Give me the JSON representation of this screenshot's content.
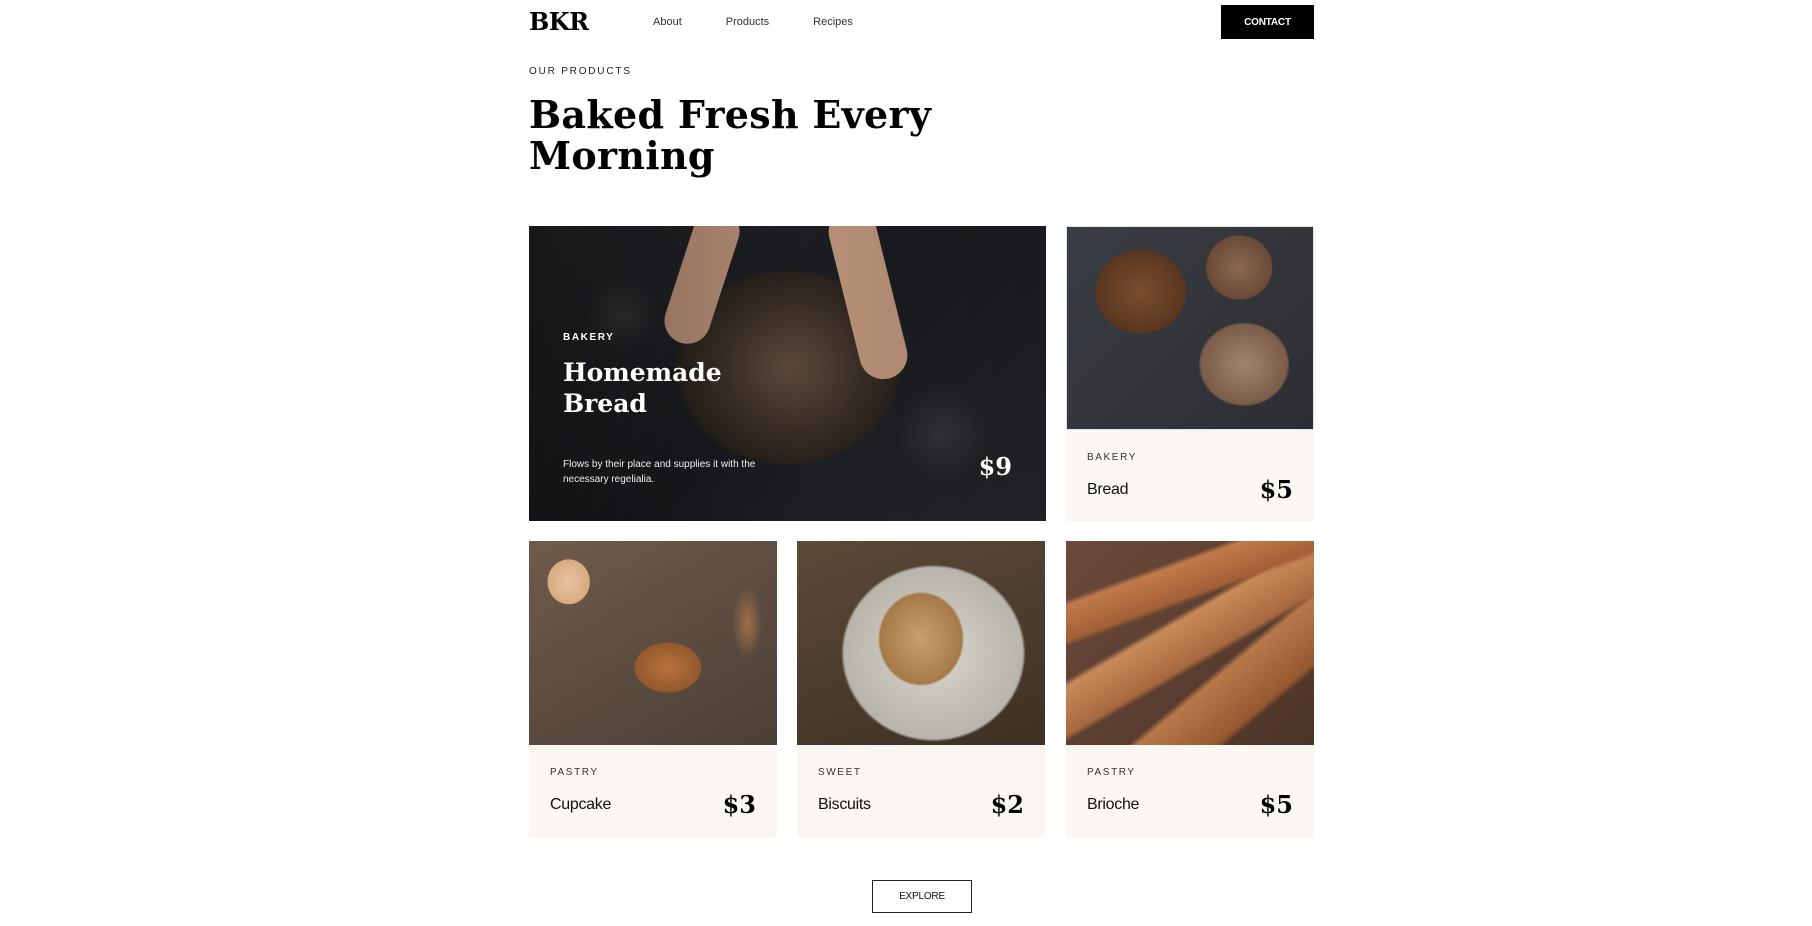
{
  "header": {
    "logo": "BKR",
    "nav": [
      "About",
      "Products",
      "Recipes"
    ],
    "contact_label": "CONTACT"
  },
  "hero": {
    "eyebrow": "OUR PRODUCTS",
    "title_line1": "Baked Fresh Every",
    "title_line2": "Morning"
  },
  "featured": {
    "category": "BAKERY",
    "title_line1": "Homemade",
    "title_line2": "Bread",
    "description": "Flows by their place and supplies it with the necessary regelialia.",
    "price": "$9"
  },
  "products": [
    {
      "category": "BAKERY",
      "name": "Bread",
      "price": "$5"
    },
    {
      "category": "PASTRY",
      "name": "Cupcake",
      "price": "$3"
    },
    {
      "category": "SWEET",
      "name": "Biscuits",
      "price": "$2"
    },
    {
      "category": "PASTRY",
      "name": "Brioche",
      "price": "$5"
    }
  ],
  "explore_label": "EXPLORE",
  "colors": {
    "accent": "#000000",
    "card_background": "#faf7f3",
    "page_background": "#ffffff"
  }
}
